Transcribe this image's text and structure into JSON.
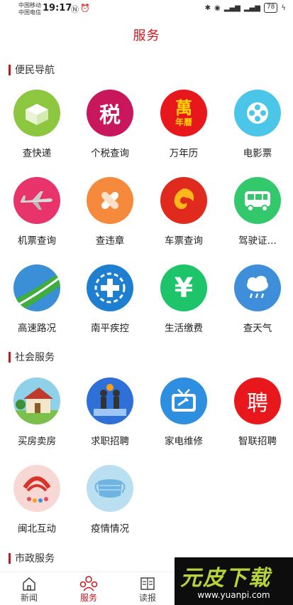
{
  "status_bar": {
    "carrier_1": "中国移动",
    "carrier_2": "中国电信",
    "time": "19:17",
    "battery": "78"
  },
  "header": {
    "title": "服务"
  },
  "sections": [
    {
      "title": "便民导航",
      "items": [
        {
          "label": "查快递",
          "icon": "package-icon",
          "color": "#8dc63f"
        },
        {
          "label": "个税查询",
          "icon": "tax-icon",
          "color": "#c8175d"
        },
        {
          "label": "万年历",
          "icon": "calendar-icon",
          "color": "#e8171c"
        },
        {
          "label": "电影票",
          "icon": "film-reel-icon",
          "color": "#4bc6e8"
        },
        {
          "label": "机票查询",
          "icon": "airplane-icon",
          "color": "#e8336b"
        },
        {
          "label": "查违章",
          "icon": "violation-icon",
          "color": "#f5893c"
        },
        {
          "label": "车票查询",
          "icon": "ticket-icon",
          "color": "#e02a1d"
        },
        {
          "label": "驾驶证…",
          "icon": "bus-icon",
          "color": "#33c86b"
        },
        {
          "label": "高速路况",
          "icon": "highway-icon",
          "color": "#3a8fd6"
        },
        {
          "label": "南平疾控",
          "icon": "medical-cross-icon",
          "color": "#1e7fd0"
        },
        {
          "label": "生活缴费",
          "icon": "yuan-icon",
          "color": "#1dc46a"
        },
        {
          "label": "查天气",
          "icon": "weather-icon",
          "color": "#3e8ed9"
        }
      ]
    },
    {
      "title": "社会服务",
      "items": [
        {
          "label": "买房卖房",
          "icon": "house-icon",
          "color": "#8ed1e8"
        },
        {
          "label": "求职招聘",
          "icon": "job-icon",
          "color": "#2e6fd8"
        },
        {
          "label": "家电维修",
          "icon": "tv-repair-icon",
          "color": "#2e8fe0"
        },
        {
          "label": "智联招聘",
          "icon": "recruit-icon",
          "color": "#e8171c"
        },
        {
          "label": "闽北互动",
          "icon": "community-icon",
          "color": "#f7d8d4"
        },
        {
          "label": "疫情情况",
          "icon": "mask-icon",
          "color": "#b9dff0"
        }
      ]
    },
    {
      "title": "市政服务",
      "items": []
    }
  ],
  "bottom_nav": [
    {
      "label": "新闻",
      "icon": "home-icon"
    },
    {
      "label": "服务",
      "icon": "service-icon",
      "active": true
    },
    {
      "label": "读报",
      "icon": "newspaper-icon"
    }
  ],
  "watermark": {
    "main": "元皮下载",
    "url": "www.yuanpi.com"
  },
  "accent_color": "#c9151e"
}
